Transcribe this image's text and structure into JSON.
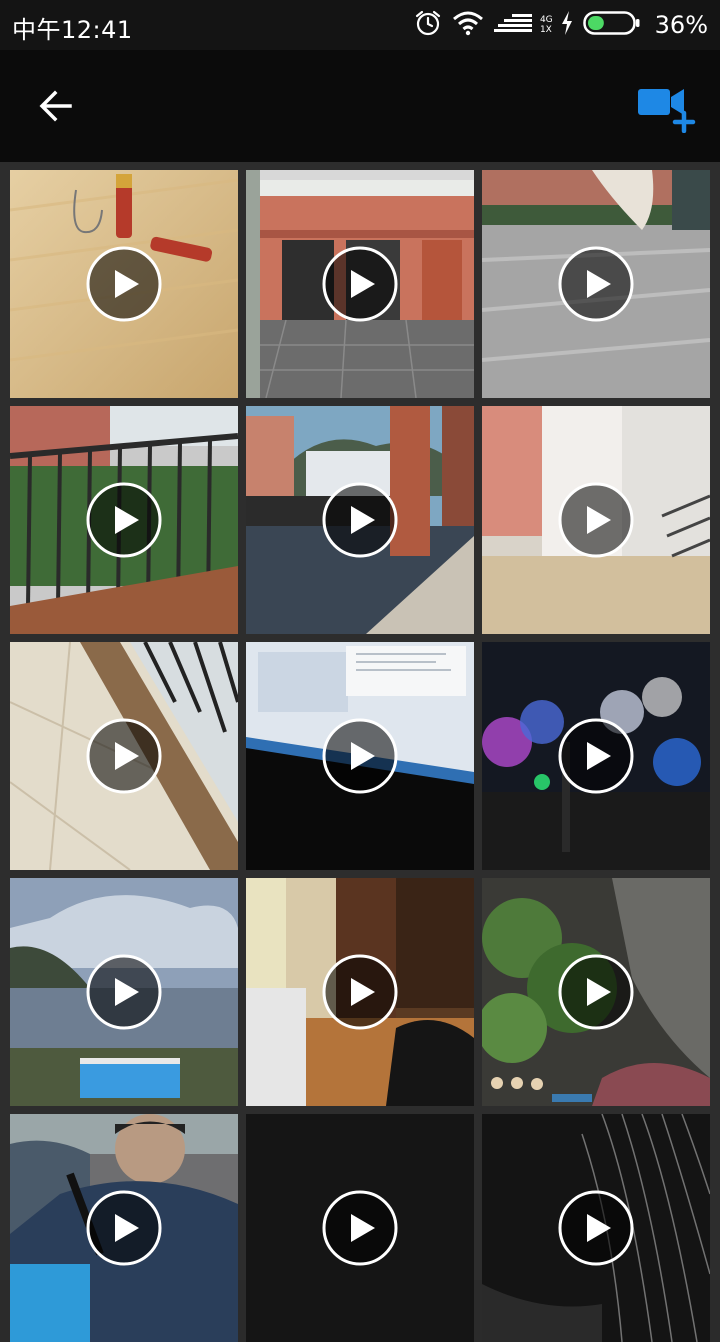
{
  "status_bar": {
    "time": "中午12:41",
    "network_top": "4G",
    "network_bottom": "1X",
    "battery": "36%",
    "battery_level": 0.36,
    "icons": [
      "alarm-icon",
      "wifi-icon",
      "signal-icon",
      "charging-icon",
      "battery-icon"
    ]
  },
  "app_bar": {
    "back_icon": "arrow-left-icon",
    "action_icon": "video-camera-add-icon",
    "accent_color": "#1e88e5"
  },
  "grid": {
    "columns": 3,
    "items": [
      {
        "name": "video-thumbnail-1",
        "scene": "battery-on-wood-table"
      },
      {
        "name": "video-thumbnail-2",
        "scene": "building-entrance"
      },
      {
        "name": "video-thumbnail-3",
        "scene": "blurred-pavement"
      },
      {
        "name": "video-thumbnail-4",
        "scene": "balcony-railing"
      },
      {
        "name": "video-thumbnail-5",
        "scene": "corridor-view"
      },
      {
        "name": "video-thumbnail-6",
        "scene": "blurred-hallway"
      },
      {
        "name": "video-thumbnail-7",
        "scene": "tiled-floor-railing"
      },
      {
        "name": "video-thumbnail-8",
        "scene": "laptop-screen"
      },
      {
        "name": "video-thumbnail-9",
        "scene": "night-light-trees"
      },
      {
        "name": "video-thumbnail-10",
        "scene": "lake-and-pool"
      },
      {
        "name": "video-thumbnail-11",
        "scene": "hotel-room"
      },
      {
        "name": "video-thumbnail-12",
        "scene": "cave-greenery"
      },
      {
        "name": "video-thumbnail-13",
        "scene": "crowd-people"
      },
      {
        "name": "video-thumbnail-14",
        "scene": "dark-black"
      },
      {
        "name": "video-thumbnail-15",
        "scene": "dark-hair-closeup"
      }
    ]
  }
}
